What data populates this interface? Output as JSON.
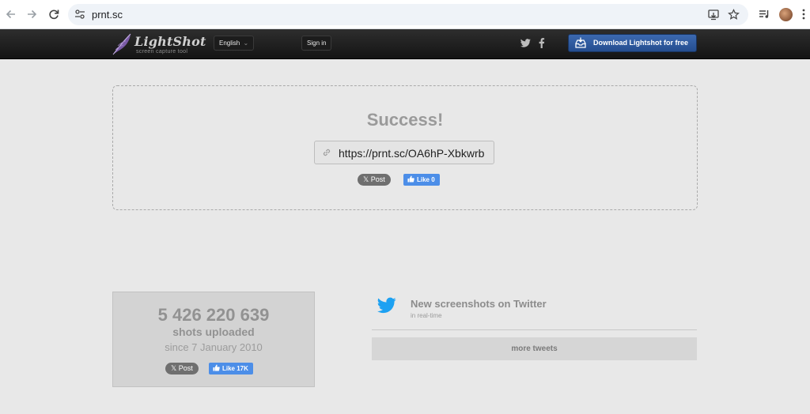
{
  "browser": {
    "url": "prnt.sc"
  },
  "header": {
    "logo_name": "LightShot",
    "logo_tagline": "screen capture tool",
    "language": "English",
    "language_caret": "⌄",
    "signin_label": "Sign in",
    "download_label": "Download Lightshot for free",
    "accent_color": "#2f5ea3"
  },
  "upload": {
    "title": "Success!",
    "link": "https://prnt.sc/OA6hP-Xbkwrb",
    "post_label": "𝕏 Post",
    "like_label": "Like 0"
  },
  "stats": {
    "count": "5 426 220 639",
    "label": "shots uploaded",
    "since": "since 7 January 2010",
    "post_label": "𝕏 Post",
    "like_label": "Like 17K"
  },
  "twitter": {
    "title": "New screenshots on Twitter",
    "subtitle": "in real-time",
    "more_label": "more tweets",
    "bird_color": "#1da1f2"
  }
}
